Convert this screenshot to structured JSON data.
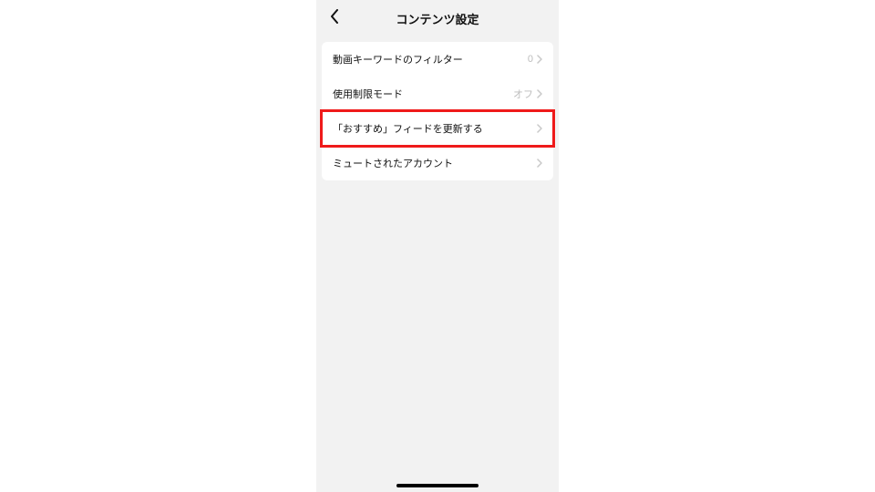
{
  "header": {
    "title": "コンテンツ設定"
  },
  "rows": [
    {
      "label": "動画キーワードのフィルター",
      "value": "0"
    },
    {
      "label": "使用制限モード",
      "value": "オフ"
    },
    {
      "label": "「おすすめ」フィードを更新する",
      "value": ""
    },
    {
      "label": "ミュートされたアカウント",
      "value": ""
    }
  ]
}
